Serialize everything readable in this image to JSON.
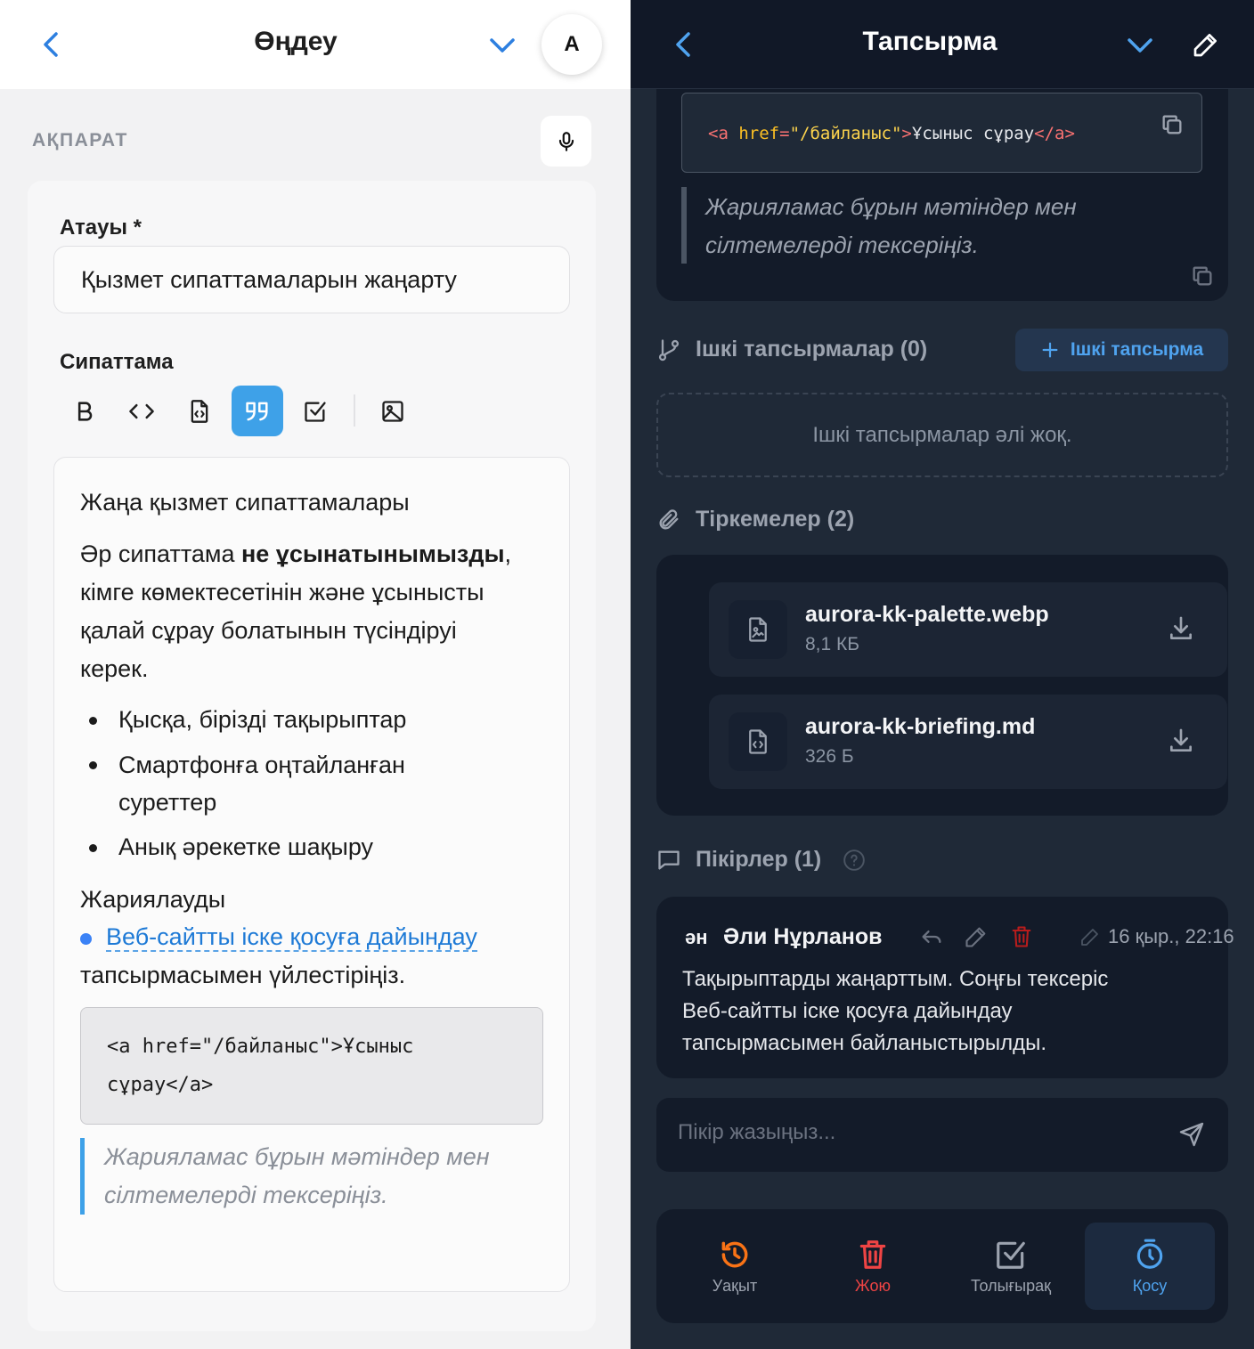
{
  "left": {
    "header": {
      "title": "Өңдеу",
      "avatar": "A"
    },
    "section_label": "АҚПАРАТ",
    "title_label": "Атауы *",
    "title_value": "Қызмет сипаттамаларын жаңарту",
    "description_label": "Сипаттама",
    "editor": {
      "heading": "Жаңа қызмет сипаттамалары",
      "para_l1_pre": "Әр сипаттама ",
      "para_l1_bold": "не ұсынатынымызды",
      "para_l1_post": ",",
      "para_l2": "кімге көмектесетінін және ұсынысты",
      "para_l3": "қалай сұрау болатынын түсіндіруі",
      "para_l4": "керек.",
      "bullet1": "Қысқа, бірізді тақырыптар",
      "bullet2_l1": "Смартфонға оңтайланған",
      "bullet2_l2": "суреттер",
      "bullet3": "Анық әрекетке шақыру",
      "publish_label": "Жариялауды",
      "link_text": "Веб-сайтты іске қосуға дайындау",
      "link_after": "тапсырмасымен үйлестіріңіз.",
      "code_l1": "<a href=\"/байланыс\">Ұсыныс",
      "code_l2": "сұрау</a>",
      "quote_l1": "Жарияламас бұрын мәтіндер мен",
      "quote_l2": "сілтемелерді тексеріңіз."
    }
  },
  "right": {
    "header": {
      "title": "Тапсырма"
    },
    "code": {
      "open_tag": "<a",
      "attr": "href",
      "eq": "=",
      "q1": "\"",
      "val": "/байланыс",
      "q2": "\"",
      "gt": ">",
      "text": "Ұсыныс сұрау",
      "close_tag": "</a>"
    },
    "quote_l1": "Жарияламас бұрын мәтіндер мен",
    "quote_l2": "сілтемелерді тексеріңіз.",
    "subtasks": {
      "title": "Ішкі тапсырмалар (0)",
      "add_label": "Ішкі тапсырма",
      "empty": "Ішкі тапсырмалар әлі жоқ."
    },
    "attachments": {
      "title": "Тіркемелер (2)",
      "files": [
        {
          "name": "aurora-kk-palette.webp",
          "size": "8,1 КБ"
        },
        {
          "name": "aurora-kk-briefing.md",
          "size": "326 Б"
        }
      ]
    },
    "comments": {
      "title": "Пікірлер (1)",
      "items": [
        {
          "initials": "ән",
          "author": "Әли Нұрланов",
          "date": "16 қыр., 22:16",
          "line1": "Тақырыптарды жаңарттым. Соңғы тексеріс",
          "line2": "Веб-сайтты іске қосуға дайындау",
          "line3": "тапсырмасымен байланыстырылды."
        }
      ],
      "input_placeholder": "Пікір жазыңыз..."
    },
    "bottom_bar": [
      {
        "label": "Уақыт",
        "color": "#f97316"
      },
      {
        "label": "Жою",
        "color": "#ef4444"
      },
      {
        "label": "Толығырақ",
        "color": "#9ca3af"
      },
      {
        "label": "Қосу",
        "color": "#4fa3ef"
      }
    ]
  }
}
